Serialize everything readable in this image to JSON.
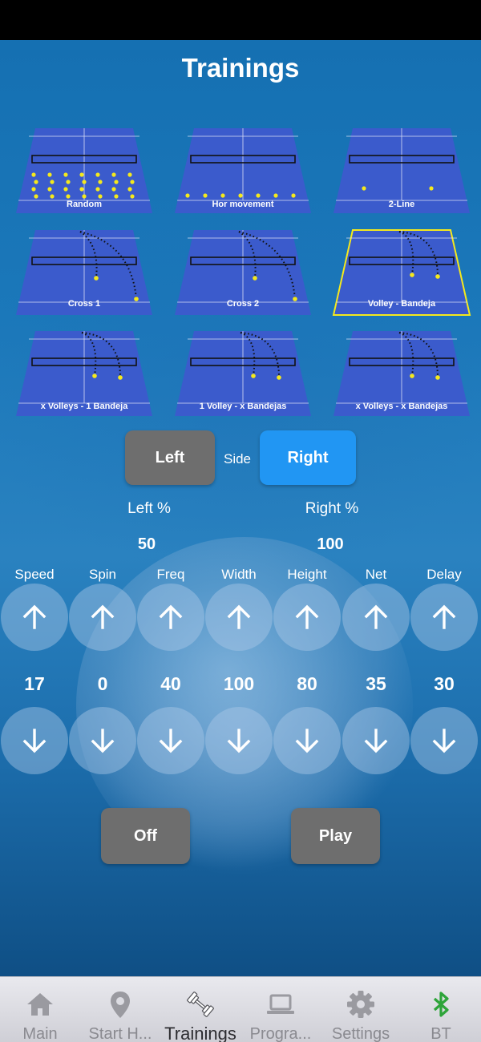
{
  "title": "Trainings",
  "colors": {
    "court": "#3b5bcc",
    "ball": "#f5e91c",
    "selected_border": "#f5e91c",
    "blue_button": "#2196f3",
    "gray_button": "#6e6e6e",
    "bt_active": "#2ea43a"
  },
  "trainings": [
    {
      "label": "Random",
      "pattern": "random"
    },
    {
      "label": "Hor movement",
      "pattern": "hor"
    },
    {
      "label": "2-Line",
      "pattern": "twoline"
    },
    {
      "label": "Cross 1",
      "pattern": "cross1"
    },
    {
      "label": "Cross 2",
      "pattern": "cross2"
    },
    {
      "label": "Volley - Bandeja",
      "pattern": "volley",
      "selected": true
    },
    {
      "label": "x Volleys - 1 Bandeja",
      "pattern": "volley"
    },
    {
      "label": "1 Volley - x Bandejas",
      "pattern": "volley"
    },
    {
      "label": "x Volleys - x Bandejas",
      "pattern": "volley"
    }
  ],
  "side": {
    "left_label": "Left",
    "side_label": "Side",
    "right_label": "Right",
    "selected": "Right"
  },
  "percent": {
    "left_label": "Left %",
    "right_label": "Right %",
    "left_value": "50",
    "right_value": "100"
  },
  "params": [
    {
      "label": "Speed",
      "value": "17"
    },
    {
      "label": "Spin",
      "value": "0"
    },
    {
      "label": "Freq",
      "value": "40"
    },
    {
      "label": "Width",
      "value": "100"
    },
    {
      "label": "Height",
      "value": "80"
    },
    {
      "label": "Net",
      "value": "35"
    },
    {
      "label": "Delay",
      "value": "30"
    }
  ],
  "controls": {
    "off_label": "Off",
    "play_label": "Play"
  },
  "nav": [
    {
      "label": "Main",
      "icon": "home-icon"
    },
    {
      "label": "Start H...",
      "icon": "location-pin-icon"
    },
    {
      "label": "Trainings",
      "icon": "dumbbell-icon",
      "active": true
    },
    {
      "label": "Progra...",
      "icon": "laptop-icon"
    },
    {
      "label": "Settings",
      "icon": "gear-icon"
    },
    {
      "label": "BT",
      "icon": "bluetooth-icon"
    }
  ]
}
